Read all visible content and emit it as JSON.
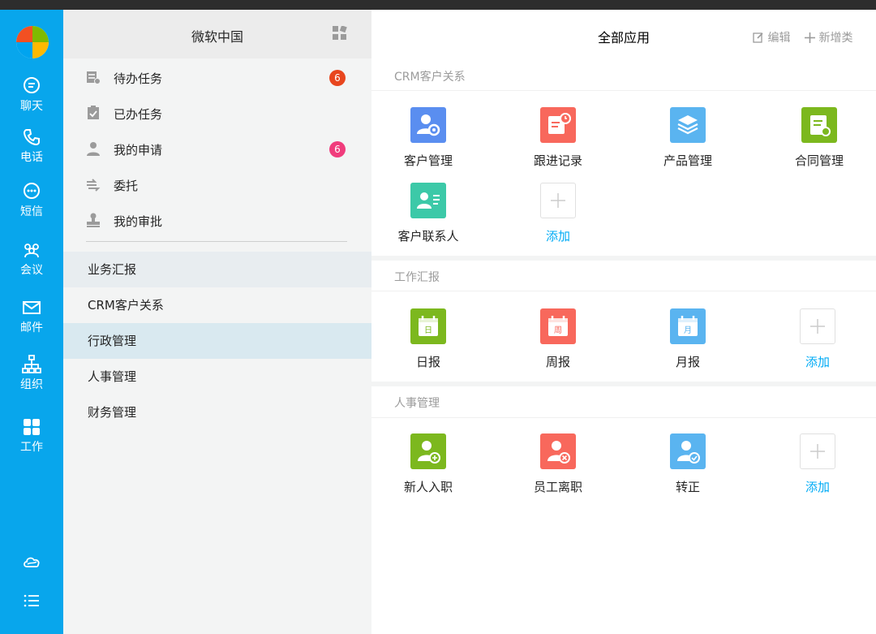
{
  "rail": {
    "items": [
      {
        "label": "聊天",
        "icon": "chat-icon"
      },
      {
        "label": "电话",
        "icon": "phone-icon"
      },
      {
        "label": "短信",
        "icon": "sms-icon"
      },
      {
        "label": "会议",
        "icon": "meeting-icon"
      },
      {
        "label": "邮件",
        "icon": "mail-icon"
      },
      {
        "label": "组织",
        "icon": "org-icon"
      },
      {
        "label": "工作",
        "icon": "work-icon"
      }
    ],
    "bottom_icons": [
      "cloud-icon",
      "list-menu-icon"
    ],
    "accent": "#08a6ec"
  },
  "left": {
    "title": "微软中国",
    "tasks": [
      {
        "label": "待办任务",
        "badge": "6",
        "badge_color": "#e8461e"
      },
      {
        "label": "已办任务"
      },
      {
        "label": "我的申请",
        "badge": "6",
        "badge_color": "#f03c7c"
      },
      {
        "label": "委托"
      },
      {
        "label": "我的审批"
      }
    ],
    "categories": [
      {
        "label": "业务汇报",
        "bg": "#e8edf0"
      },
      {
        "label": "CRM客户关系"
      },
      {
        "label": "行政管理",
        "bg": "#d9e9f0",
        "active": true
      },
      {
        "label": "人事管理"
      },
      {
        "label": "财务管理"
      }
    ]
  },
  "right": {
    "title": "全部应用",
    "edit_label": "编辑",
    "add_label": "新增类",
    "sections": [
      {
        "title": "CRM客户关系",
        "apps": [
          {
            "label": "客户管理",
            "icon": "customer-manage-icon",
            "color": "#5a8ef0"
          },
          {
            "label": "跟进记录",
            "icon": "follow-record-icon",
            "color": "#f8685c"
          },
          {
            "label": "产品管理",
            "icon": "product-manage-icon",
            "color": "#5ab4f0"
          },
          {
            "label": "合同管理",
            "icon": "contract-manage-icon",
            "color": "#7cb81e"
          },
          {
            "label": "客户联系人",
            "icon": "contact-icon",
            "color": "#3cc9a8"
          },
          {
            "label": "添加",
            "icon": "add-icon",
            "add": true
          }
        ]
      },
      {
        "title": "工作汇报",
        "apps": [
          {
            "label": "日报",
            "icon": "daily-report-icon",
            "color": "#7cb81e",
            "glyph": "日"
          },
          {
            "label": "周报",
            "icon": "weekly-report-icon",
            "color": "#f8685c",
            "glyph": "周"
          },
          {
            "label": "月报",
            "icon": "monthly-report-icon",
            "color": "#5ab4f0",
            "glyph": "月"
          },
          {
            "label": "添加",
            "icon": "add-icon",
            "add": true
          }
        ]
      },
      {
        "title": "人事管理",
        "apps": [
          {
            "label": "新人入职",
            "icon": "onboard-icon",
            "color": "#7cb81e"
          },
          {
            "label": "员工离职",
            "icon": "resign-icon",
            "color": "#f8685c"
          },
          {
            "label": "转正",
            "icon": "regularize-icon",
            "color": "#5ab4f0"
          },
          {
            "label": "添加",
            "icon": "add-icon",
            "add": true
          }
        ]
      }
    ]
  }
}
